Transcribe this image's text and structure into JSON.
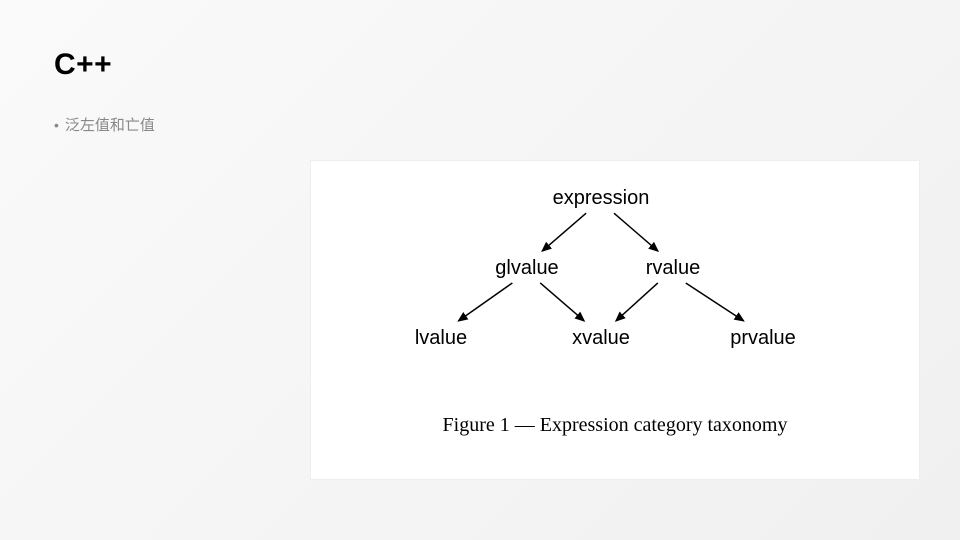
{
  "title": "C++",
  "bullet": "泛左值和亡值",
  "diagram": {
    "nodes": {
      "expression": "expression",
      "glvalue": "glvalue",
      "rvalue": "rvalue",
      "lvalue": "lvalue",
      "xvalue": "xvalue",
      "prvalue": "prvalue"
    },
    "caption": "Figure 1 — Expression category taxonomy"
  }
}
